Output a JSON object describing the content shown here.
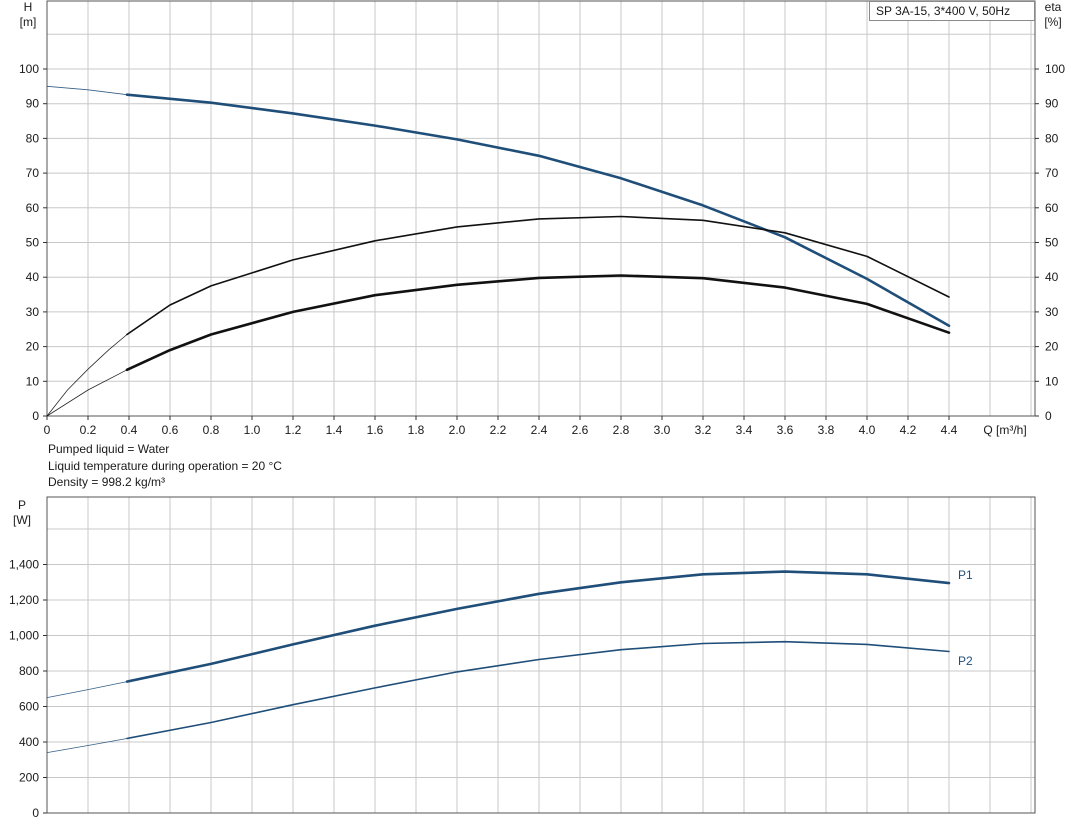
{
  "model_label": "SP 3A-15, 3*400 V, 50Hz",
  "info": [
    "Pumped liquid = Water",
    "Liquid temperature during operation = 20 °C",
    "Density = 998.2 kg/m³"
  ],
  "colors": {
    "blue": "#1f4e79",
    "black": "#111111",
    "grid": "#c8c8c8"
  },
  "chart_data": [
    {
      "type": "line",
      "title": "",
      "x_label": "Q [m³/h]",
      "y_left_label": [
        "H",
        "[m]"
      ],
      "y_right_label": [
        "eta",
        "[%]"
      ],
      "xlim": [
        0,
        4.8
      ],
      "ylim": [
        0,
        110
      ],
      "x_ticks": [
        "0",
        "0.2",
        "0.4",
        "0.6",
        "0.8",
        "1.0",
        "1.2",
        "1.4",
        "1.6",
        "1.8",
        "2.0",
        "2.2",
        "2.4",
        "2.6",
        "2.8",
        "3.0",
        "3.2",
        "3.4",
        "3.6",
        "3.8",
        "4.0",
        "4.2",
        "4.4"
      ],
      "y_ticks": [
        "0",
        "10",
        "20",
        "30",
        "40",
        "50",
        "60",
        "70",
        "80",
        "90",
        "100"
      ],
      "grid": true,
      "series": [
        {
          "id": "head",
          "color": "blue",
          "x": [
            0.39,
            0.8,
            1.2,
            1.6,
            2.0,
            2.4,
            2.8,
            3.2,
            3.6,
            4.0,
            4.4
          ],
          "y": [
            92.6,
            90.3,
            87.2,
            83.7,
            79.7,
            75.0,
            68.5,
            60.7,
            51.5,
            39.5,
            26.0
          ],
          "ext_x": [
            0.0,
            0.2,
            0.39
          ],
          "ext_y": [
            95.0,
            94.0,
            92.6
          ]
        },
        {
          "id": "eta-1",
          "color": "black",
          "x": [
            0.39,
            0.6,
            0.8,
            1.2,
            1.6,
            2.0,
            2.4,
            2.8,
            3.2,
            3.6,
            4.0,
            4.4
          ],
          "y": [
            23.5,
            32.0,
            37.5,
            45.0,
            50.5,
            54.5,
            56.8,
            57.5,
            56.4,
            52.8,
            46.0,
            34.3
          ],
          "ext_x": [
            0.0,
            0.1,
            0.2,
            0.3,
            0.39
          ],
          "ext_y": [
            0.0,
            7.5,
            13.5,
            19.0,
            23.5
          ]
        },
        {
          "id": "eta-2",
          "color": "black",
          "x": [
            0.39,
            0.6,
            0.8,
            1.2,
            1.6,
            2.0,
            2.4,
            2.8,
            3.2,
            3.6,
            4.0,
            4.4
          ],
          "y": [
            13.3,
            19.0,
            23.5,
            30.0,
            34.8,
            37.8,
            39.8,
            40.5,
            39.7,
            37.0,
            32.3,
            24.0
          ],
          "ext_x": [
            0.0,
            0.2,
            0.39
          ],
          "ext_y": [
            0.0,
            7.5,
            13.3
          ]
        }
      ]
    },
    {
      "type": "line",
      "title": "",
      "x_label": "",
      "y_left_label": [
        "P",
        "[W]"
      ],
      "xlim": [
        0,
        4.8
      ],
      "ylim": [
        0,
        1750
      ],
      "y_ticks": [
        "0",
        "200",
        "400",
        "600",
        "800",
        "1,000",
        "1,200",
        "1,400"
      ],
      "grid": true,
      "series": [
        {
          "id": "P1",
          "name": "P1",
          "color": "blue",
          "x": [
            0.39,
            0.8,
            1.2,
            1.6,
            2.0,
            2.4,
            2.8,
            3.2,
            3.6,
            4.0,
            4.4
          ],
          "y": [
            740,
            840,
            950,
            1055,
            1150,
            1235,
            1300,
            1345,
            1360,
            1345,
            1295
          ],
          "ext_x": [
            0.0,
            0.2,
            0.39
          ],
          "ext_y": [
            650,
            695,
            740
          ]
        },
        {
          "id": "P2",
          "name": "P2",
          "color": "blue",
          "x": [
            0.39,
            0.8,
            1.2,
            1.6,
            2.0,
            2.4,
            2.8,
            3.2,
            3.6,
            4.0,
            4.4
          ],
          "y": [
            420,
            510,
            610,
            705,
            795,
            865,
            920,
            955,
            965,
            950,
            910
          ],
          "ext_x": [
            0.0,
            0.2,
            0.39
          ],
          "ext_y": [
            340,
            380,
            420
          ]
        }
      ]
    }
  ]
}
